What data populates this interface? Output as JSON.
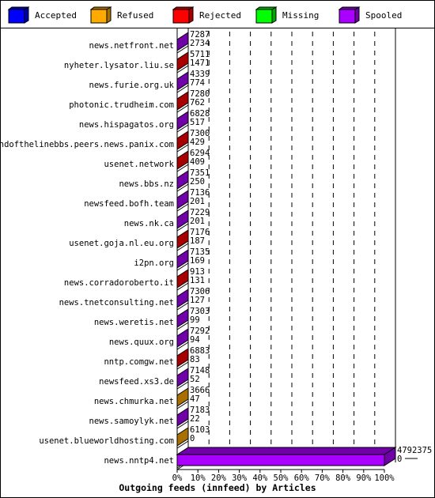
{
  "legend": [
    {
      "label": "Accepted",
      "front": "#0000ff",
      "side": "#0000a8"
    },
    {
      "label": "Refused",
      "front": "#ffaa00",
      "side": "#a87000"
    },
    {
      "label": "Rejected",
      "front": "#ff0000",
      "side": "#a80000"
    },
    {
      "label": "Missing",
      "front": "#00ff00",
      "side": "#00a800"
    },
    {
      "label": "Spooled",
      "front": "#aa00ff",
      "side": "#7000a8"
    }
  ],
  "chart_data": {
    "type": "bar",
    "orientation": "horizontal",
    "stacked": true,
    "title": "Outgoing feeds (innfeed) by Articles",
    "xlabel": "",
    "ylabel": "",
    "xlim": [
      0,
      100
    ],
    "x_ticks": [
      "0%",
      "10%",
      "20%",
      "30%",
      "40%",
      "50%",
      "60%",
      "70%",
      "80%",
      "90%",
      "100%"
    ],
    "grid": "vertical dashed",
    "legend_position": "top",
    "series_names": [
      "Accepted",
      "Refused",
      "Rejected",
      "Missing",
      "Spooled"
    ],
    "categories": [
      "news.netfront.net",
      "nyheter.lysator.liu.se",
      "news.furie.org.uk",
      "photonic.trudheim.com",
      "news.hispagatos.org",
      "endofthelinebbs.peers.news.panix.com",
      "usenet.network",
      "news.bbs.nz",
      "newsfeed.bofh.team",
      "news.nk.ca",
      "usenet.goja.nl.eu.org",
      "i2pn.org",
      "news.corradoroberto.it",
      "news.tnetconsulting.net",
      "news.weretis.net",
      "news.quux.org",
      "nntp.comgw.net",
      "newsfeed.xs3.de",
      "news.chmurka.net",
      "news.samoylyk.net",
      "usenet.blueworldhosting.com",
      "news.nntp4.net"
    ],
    "top_labels": [
      "7287",
      "5711",
      "4339",
      "7280",
      "6828",
      "7300",
      "6294",
      "7351",
      "7136",
      "7229",
      "7176",
      "7135",
      "913",
      "7306",
      "7303",
      "7292",
      "6883",
      "7148",
      "3666",
      "7183",
      "6103",
      "4792375"
    ],
    "bottom_labels": [
      "2734",
      "1471",
      "774",
      "762",
      "517",
      "429",
      "409",
      "250",
      "201",
      "201",
      "187",
      "169",
      "131",
      "127",
      "99",
      "94",
      "83",
      "52",
      "47",
      "22",
      "0",
      "0"
    ],
    "dominant_series": [
      "Spooled",
      "Rejected",
      "Spooled",
      "Rejected",
      "Spooled",
      "Rejected",
      "Rejected",
      "Spooled",
      "Spooled",
      "Spooled",
      "Rejected",
      "Spooled",
      "Rejected",
      "Spooled",
      "Spooled",
      "Spooled",
      "Rejected",
      "Spooled",
      "Refused",
      "Spooled",
      "Refused",
      "Spooled"
    ],
    "bar_percent": [
      0.15,
      0.12,
      0.09,
      0.15,
      0.14,
      0.15,
      0.13,
      0.15,
      0.15,
      0.15,
      0.15,
      0.15,
      0.02,
      0.15,
      0.15,
      0.15,
      0.14,
      0.15,
      0.08,
      0.15,
      0.13,
      100
    ]
  }
}
